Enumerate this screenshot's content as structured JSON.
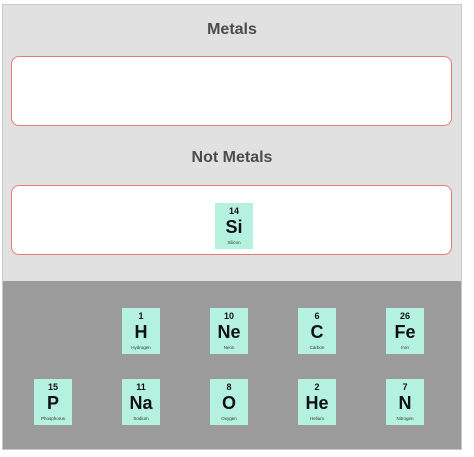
{
  "zones": {
    "metals_title": "Metals",
    "not_metals_title": "Not Metals"
  },
  "placed": {
    "not_metals": [
      {
        "number": "14",
        "symbol": "Si",
        "name": "Silicon"
      }
    ]
  },
  "tray": [
    {
      "number": "1",
      "symbol": "H",
      "name": "Hydrogen"
    },
    {
      "number": "10",
      "symbol": "Ne",
      "name": "Neon"
    },
    {
      "number": "6",
      "symbol": "C",
      "name": "Carbon"
    },
    {
      "number": "26",
      "symbol": "Fe",
      "name": "Iron"
    },
    {
      "number": "15",
      "symbol": "P",
      "name": "Phosphorus"
    },
    {
      "number": "11",
      "symbol": "Na",
      "name": "Sodium"
    },
    {
      "number": "8",
      "symbol": "O",
      "name": "Oxygen"
    },
    {
      "number": "2",
      "symbol": "He",
      "name": "Helium"
    },
    {
      "number": "7",
      "symbol": "N",
      "name": "Nitrogen"
    }
  ],
  "colors": {
    "card_background": "#b5f1df",
    "zone_border": "#e87a7a",
    "tray_background": "#9b9b9b",
    "upper_background": "#e1e1e1"
  }
}
